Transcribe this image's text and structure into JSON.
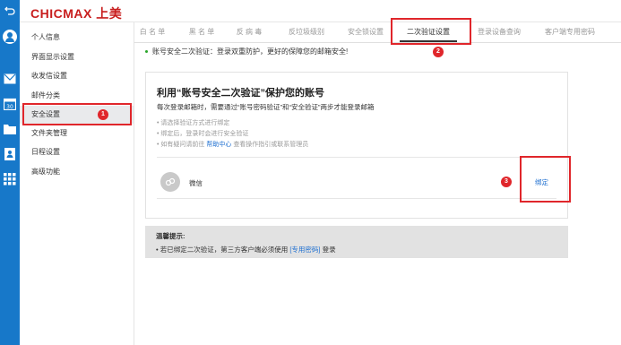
{
  "app": {
    "logo": "CHICMAX 上美"
  },
  "sidebar": {
    "items": [
      {
        "label": "个人信息"
      },
      {
        "label": "界面显示设置"
      },
      {
        "label": "收发信设置"
      },
      {
        "label": "邮件分类"
      },
      {
        "label": "安全设置"
      },
      {
        "label": "文件夹管理"
      },
      {
        "label": "日程设置"
      },
      {
        "label": "高级功能"
      }
    ]
  },
  "tabs": [
    {
      "label": "白 名 单"
    },
    {
      "label": "黑 名 单"
    },
    {
      "label": "反 病 毒"
    },
    {
      "label": "反垃圾级别"
    },
    {
      "label": "安全锁设置"
    },
    {
      "label": "二次验证设置"
    },
    {
      "label": "登录设备查询"
    },
    {
      "label": "客户端专用密码"
    }
  ],
  "notice": "账号安全二次验证：登录双重防护，更好的保障您的邮箱安全!",
  "card": {
    "title": "利用“账号安全二次验证”保护您的账号",
    "subtitle": "每次登录邮箱时，需要通过“账号密码验证”和“安全验证”两步才能登录邮箱",
    "bullets": [
      "请选择验证方式进行绑定",
      "绑定后，登录时会进行安全验证"
    ],
    "help_prefix": "如有疑问请前往",
    "help_link": "帮助中心",
    "help_suffix": "查看操作指引或联系管理员",
    "method": {
      "label": "微信",
      "action": "绑定"
    }
  },
  "tip": {
    "title": "温馨提示:",
    "text_prefix": "若已绑定二次验证，第三方客户端必须使用",
    "link": "[专用密码]",
    "text_suffix": "登录"
  },
  "annotations": {
    "badge1": "1",
    "badge2": "2",
    "badge3": "3"
  },
  "colors": {
    "rail": "#1778c9",
    "highlight": "#e0262b",
    "link": "#1e6fd0",
    "logo": "#c81e1e"
  }
}
